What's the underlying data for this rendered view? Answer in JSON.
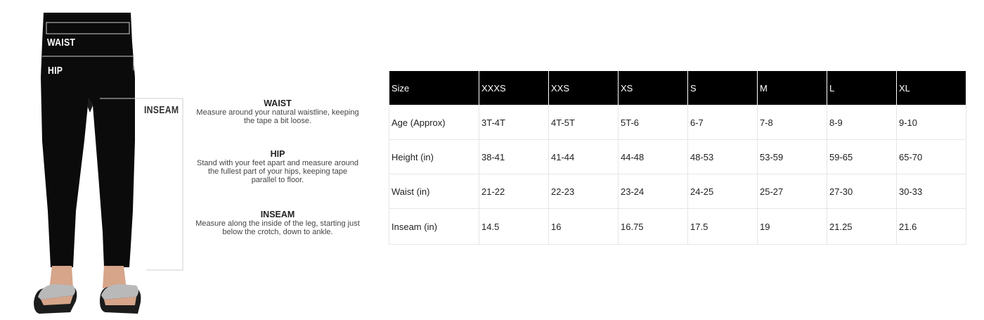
{
  "figure": {
    "waist_label": "WAIST",
    "hip_label": "HIP",
    "inseam_label": "INSEAM"
  },
  "instructions": [
    {
      "title": "WAIST",
      "lines": [
        "Measure around your natural waistline, keeping",
        "the tape a bit loose."
      ]
    },
    {
      "title": "HIP",
      "lines": [
        "Stand with your feet apart and measure around",
        "the fullest part of your hips, keeping tape",
        "parallel to floor."
      ]
    },
    {
      "title": "INSEAM",
      "lines": [
        "Measure along the inside of the leg, starting just",
        "below the crotch, down to ankle."
      ]
    }
  ],
  "table": {
    "header": [
      "Size",
      "XXXS",
      "XXS",
      "XS",
      "S",
      "M",
      "L",
      "XL"
    ],
    "rows": [
      [
        "Age (Approx)",
        "3T-4T",
        "4T-5T",
        "5T-6",
        "6-7",
        "7-8",
        "8-9",
        "9-10"
      ],
      [
        "Height (in)",
        "38-41",
        "41-44",
        "44-48",
        "48-53",
        "53-59",
        "59-65",
        "65-70"
      ],
      [
        "Waist (in)",
        "21-22",
        "22-23",
        "23-24",
        "24-25",
        "25-27",
        "27-30",
        "30-33"
      ],
      [
        "Inseam (in)",
        "14.5",
        "16",
        "16.75",
        "17.5",
        "19",
        "21.25",
        "21.6"
      ]
    ]
  },
  "colors": {
    "header_bg": "#000000",
    "header_text": "#ffffff",
    "garment": "#0b0b0b",
    "slide": "#b9b9b9"
  }
}
